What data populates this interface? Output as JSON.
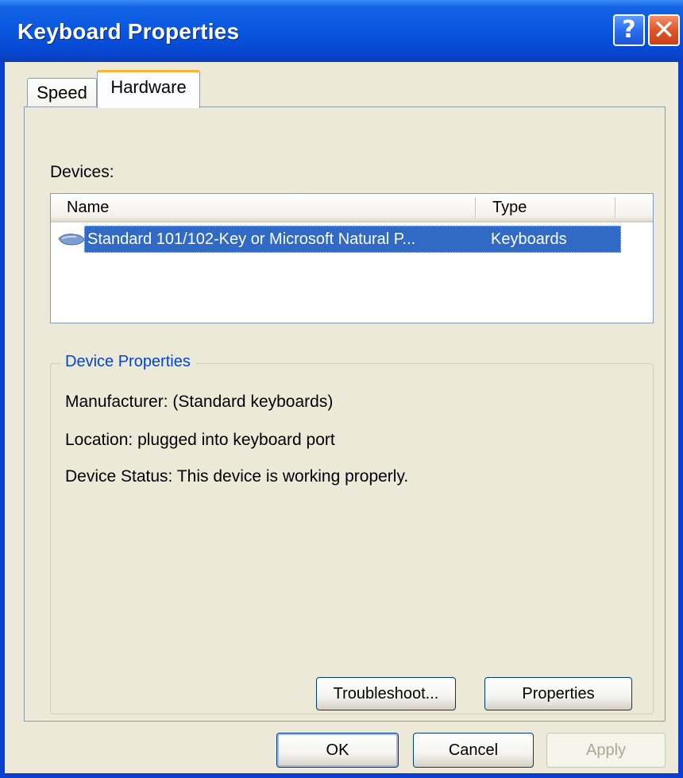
{
  "window": {
    "title": "Keyboard Properties",
    "help_glyph": "?",
    "close_glyph": "✕"
  },
  "tabs": [
    {
      "label": "Speed",
      "selected": false
    },
    {
      "label": "Hardware",
      "selected": true
    }
  ],
  "devices": {
    "label": "Devices:",
    "columns": {
      "name": "Name",
      "type": "Type"
    },
    "rows": [
      {
        "icon": "keyboard-icon",
        "name": "Standard 101/102-Key or Microsoft Natural P...",
        "type": "Keyboards",
        "selected": true
      }
    ]
  },
  "device_properties": {
    "legend": "Device Properties",
    "manufacturer": "Manufacturer: (Standard keyboards)",
    "location": "Location: plugged into keyboard port",
    "status": "Device Status: This device is working properly.",
    "troubleshoot_label": "Troubleshoot...",
    "properties_label": "Properties"
  },
  "footer": {
    "ok_label": "OK",
    "cancel_label": "Cancel",
    "apply_label": "Apply",
    "apply_enabled": false
  },
  "colors": {
    "titlebar": "#0a58e0",
    "selection": "#316ac5",
    "group_legend": "#0046d5",
    "dialog_face": "#ece9d8"
  }
}
